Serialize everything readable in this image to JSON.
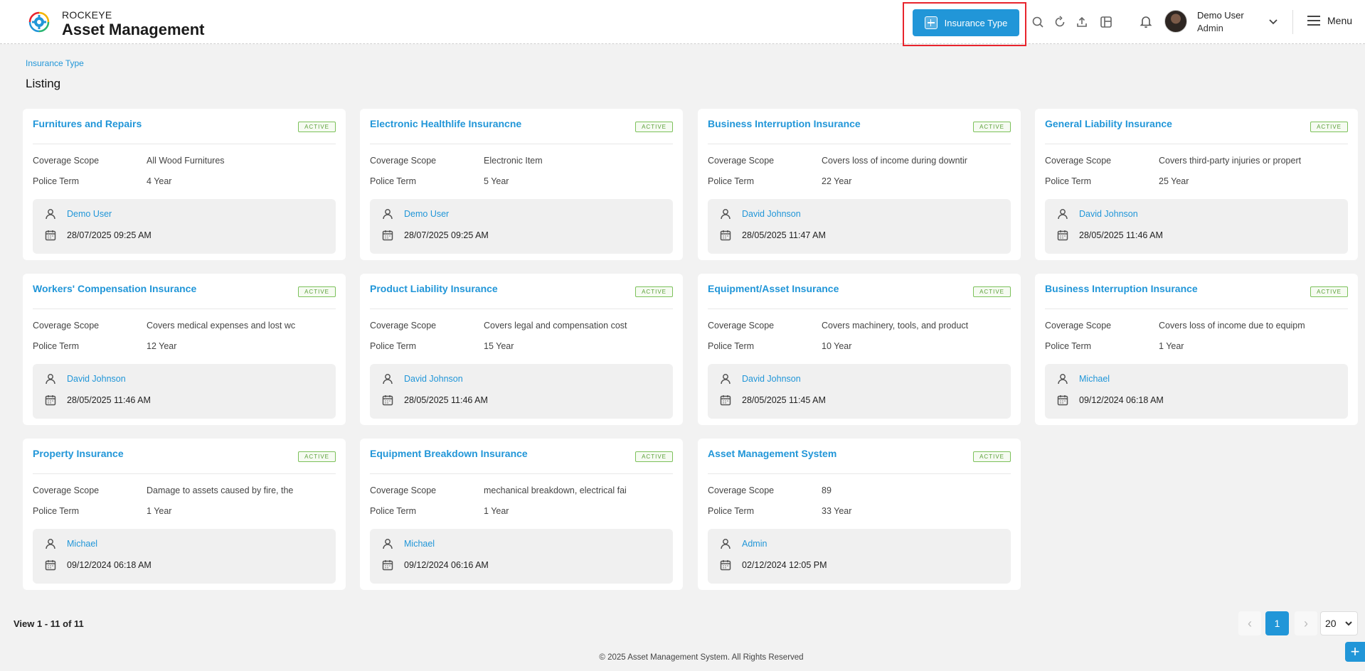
{
  "header": {
    "brand_top": "ROCKEYE",
    "brand_main": "Asset Management",
    "primary_button_label": "Insurance Type",
    "user_name": "Demo User",
    "user_role": "Admin",
    "menu_label": "Menu"
  },
  "breadcrumb": "Insurance Type",
  "page_title": "Listing",
  "labels": {
    "coverage": "Coverage Scope",
    "term": "Police Term",
    "status": "ACTIVE"
  },
  "cards": [
    {
      "title": "Furnitures and Repairs",
      "coverage": "All Wood Furnitures",
      "term": "4 Year",
      "user": "Demo User",
      "date": "28/07/2025 09:25 AM"
    },
    {
      "title": "Electronic Healthlife Insurancne",
      "coverage": "Electronic Item",
      "term": "5 Year",
      "user": "Demo User",
      "date": "28/07/2025 09:25 AM"
    },
    {
      "title": "Business Interruption Insurance",
      "coverage": "Covers loss of income during downtir",
      "term": "22 Year",
      "user": "David Johnson",
      "date": "28/05/2025 11:47 AM"
    },
    {
      "title": "General Liability Insurance",
      "coverage": "Covers third-party injuries or propert",
      "term": "25 Year",
      "user": "David Johnson",
      "date": "28/05/2025 11:46 AM"
    },
    {
      "title": "Workers' Compensation Insurance",
      "coverage": "Covers medical expenses and lost wc",
      "term": "12 Year",
      "user": "David Johnson",
      "date": "28/05/2025 11:46 AM"
    },
    {
      "title": "Product Liability Insurance",
      "coverage": "Covers legal and compensation cost",
      "term": "15 Year",
      "user": "David Johnson",
      "date": "28/05/2025 11:46 AM"
    },
    {
      "title": "Equipment/Asset Insurance",
      "coverage": "Covers machinery, tools, and product",
      "term": "10 Year",
      "user": "David Johnson",
      "date": "28/05/2025 11:45 AM"
    },
    {
      "title": "Business Interruption Insurance",
      "coverage": "Covers loss of income due to equipm",
      "term": "1 Year",
      "user": "Michael",
      "date": "09/12/2024 06:18 AM"
    },
    {
      "title": "Property Insurance",
      "coverage": "Damage to assets caused by fire, the",
      "term": "1 Year",
      "user": "Michael",
      "date": "09/12/2024 06:18 AM"
    },
    {
      "title": "Equipment Breakdown Insurance",
      "coverage": "mechanical breakdown, electrical fai",
      "term": "1 Year",
      "user": "Michael",
      "date": "09/12/2024 06:16 AM"
    },
    {
      "title": "Asset Management System",
      "coverage": "89",
      "term": "33 Year",
      "user": "Admin",
      "date": "02/12/2024 12:05 PM"
    }
  ],
  "footer": {
    "view_count": "View 1 - 11 of 11",
    "current_page": "1",
    "page_size": "20",
    "copyright": "© 2025 Asset Management System. All Rights Reserved",
    "prev_glyph": "‹",
    "next_glyph": "›",
    "fab_glyph": "+"
  },
  "colors": {
    "accent": "#2196d8",
    "active_badge": "#5ca03a",
    "highlight": "#e8242d"
  },
  "icons": {
    "logo": "gear-logo-icon",
    "search": "search-icon",
    "refresh": "refresh-icon",
    "upload": "upload-icon",
    "layout": "layout-icon",
    "bell": "bell-icon",
    "user": "user-icon",
    "calendar": "calendar-icon"
  }
}
